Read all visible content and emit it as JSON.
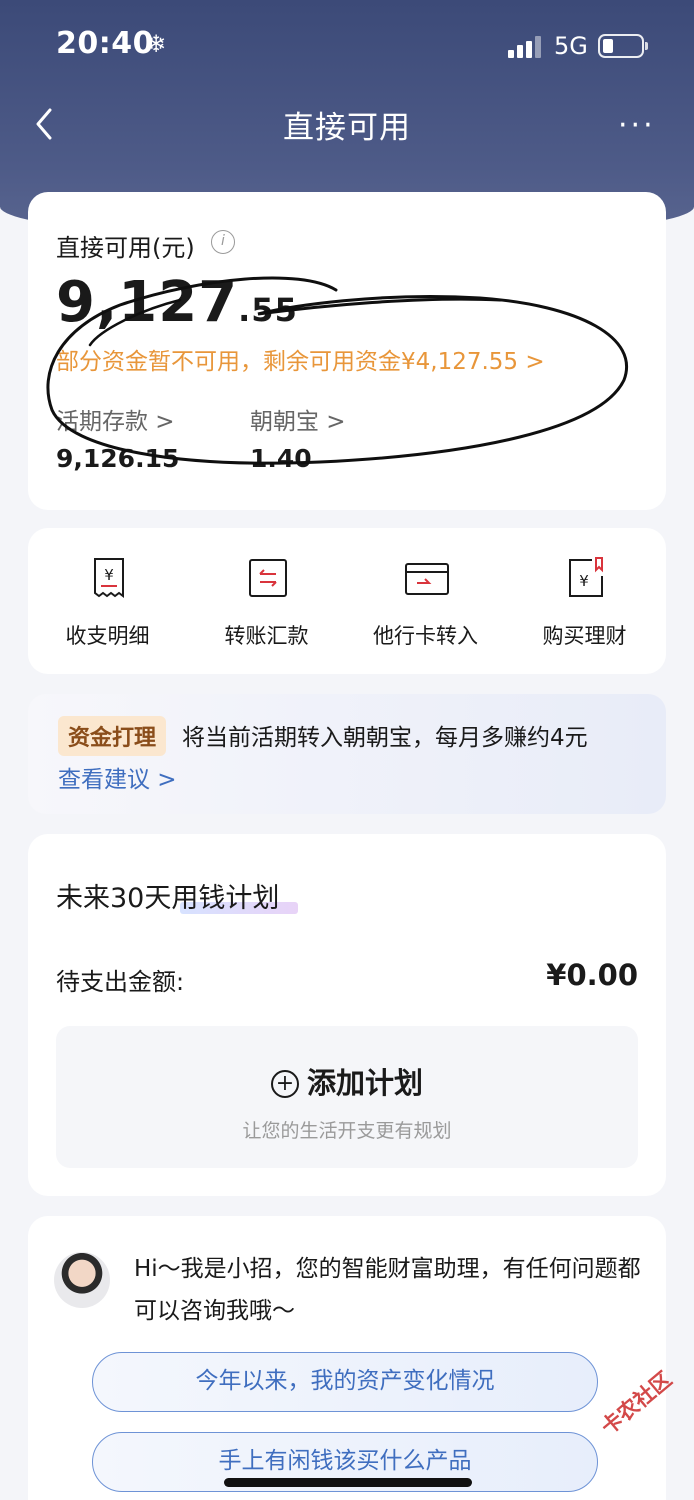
{
  "status_bar": {
    "time": "20:40",
    "network": "5G"
  },
  "nav": {
    "title": "直接可用"
  },
  "balance": {
    "label": "直接可用(元)",
    "amount_int": "9,127",
    "amount_dec": ".55",
    "notice": "部分资金暂不可用，剩余可用资金¥4,127.55 >",
    "accounts": [
      {
        "label": "活期存款 >",
        "value": "9,126.15"
      },
      {
        "label": "朝朝宝 >",
        "value": "1.40"
      }
    ]
  },
  "actions": [
    {
      "label": "收支明细",
      "icon": "receipt-yen-icon"
    },
    {
      "label": "转账汇款",
      "icon": "transfer-icon"
    },
    {
      "label": "他行卡转入",
      "icon": "card-transfer-in-icon"
    },
    {
      "label": "购买理财",
      "icon": "buy-wealth-icon"
    }
  ],
  "tip": {
    "tag": "资金打理",
    "text": "将当前活期转入朝朝宝，每月多赚约4元",
    "link": "查看建议 >"
  },
  "plan": {
    "title": "未来30天用钱计划",
    "pending_label": "待支出金额:",
    "pending_value": "¥0.00",
    "add_label": "添加计划",
    "add_sub": "让您的生活开支更有规划"
  },
  "assistant": {
    "greeting": "Hi～我是小招，您的智能财富助理，有任何问题都可以咨询我哦～",
    "questions": [
      "今年以来，我的资产变化情况",
      "手上有闲钱该买什么产品"
    ]
  },
  "watermark": "卡农社区",
  "colors": {
    "header": "#3c4a78",
    "notice": "#e8963a",
    "link": "#3f6ebf",
    "accent_red": "#d9343c"
  }
}
